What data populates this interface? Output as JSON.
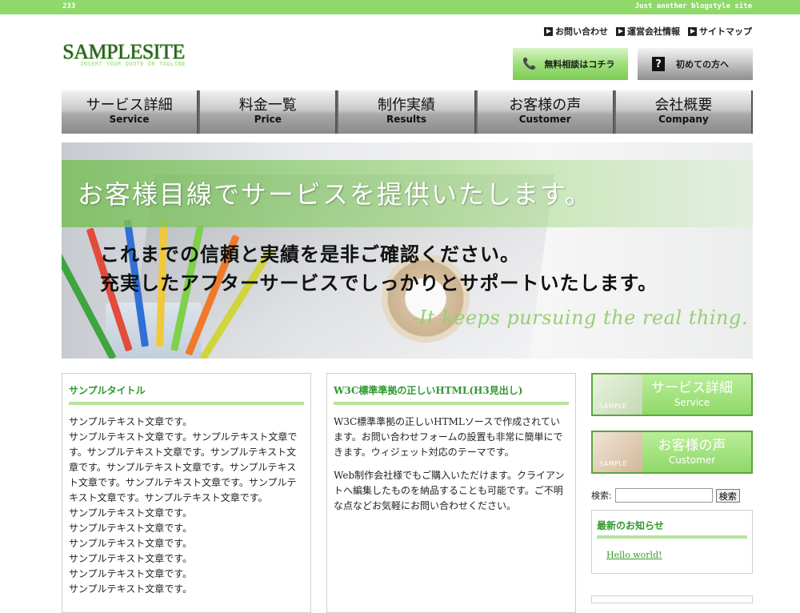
{
  "topbar": {
    "left": "233",
    "right": "Just another blogstyle site"
  },
  "logo": {
    "name": "SAMPLESITE",
    "tagline": "INSERT YOUR QUOTE OR TAGLINE"
  },
  "toplinks": [
    "お問い合わせ",
    "運営会社情報",
    "サイトマップ"
  ],
  "header_buttons": {
    "contact": "無料相談はコチラ",
    "first": "初めての方へ"
  },
  "nav": [
    {
      "jp": "サービス詳細",
      "en": "Service"
    },
    {
      "jp": "料金一覧",
      "en": "Price"
    },
    {
      "jp": "制作実績",
      "en": "Results"
    },
    {
      "jp": "お客様の声",
      "en": "Customer"
    },
    {
      "jp": "会社概要",
      "en": "Company"
    }
  ],
  "hero": {
    "title": "お客様目線でサービスを提供いたします。",
    "line1": "これまでの信頼と実績を是非ご確認ください。",
    "line2": "充実したアフターサービスでしっかりとサポートいたします。",
    "tagline": "-It keeps pursuing the real thing."
  },
  "box1": {
    "title": "サンプルタイトル",
    "text": [
      "サンプルテキスト文章です。",
      "サンプルテキスト文章です。サンプルテキスト文章です。サンプルテキスト文章です。サンプルテキスト文章です。サンプルテキスト文章です。サンプルテキスト文章です。サンプルテキスト文章です。サンプルテキスト文章です。サンプルテキスト文章です。",
      "サンプルテキスト文章です。",
      "サンプルテキスト文章です。",
      "サンプルテキスト文章です。",
      "サンプルテキスト文章です。",
      "サンプルテキスト文章です。",
      "サンプルテキスト文章です。"
    ]
  },
  "box2": {
    "title": "W3C標準準拠の正しいHTML(H3見出し)",
    "p1": "W3C標準準拠の正しいHTMLソースで作成されています。お問い合わせフォームの設置も非常に簡単にできます。ウィジェット対応のテーマです。",
    "p2": "Web制作会社様でもご購入いただけます。クライアントへ編集したものを納品することも可能です。ご不明な点などお気軽にお問い合わせください。"
  },
  "sidebar": {
    "buttons": [
      {
        "jp": "サービス詳細",
        "en": "Service",
        "sample": "SAMPLE"
      },
      {
        "jp": "お客様の声",
        "en": "Customer",
        "sample": "SAMPLE"
      }
    ],
    "search_label": "検索:",
    "search_value": "",
    "search_button": "検索",
    "news_title": "最新のお知らせ",
    "news_link": "Hello world!"
  },
  "colors": {
    "accent": "#8fd86a",
    "heading": "#2f9a2f"
  },
  "icons": {
    "phone": "phone-icon",
    "question": "question-icon",
    "arrow": "arrow-right-icon"
  }
}
